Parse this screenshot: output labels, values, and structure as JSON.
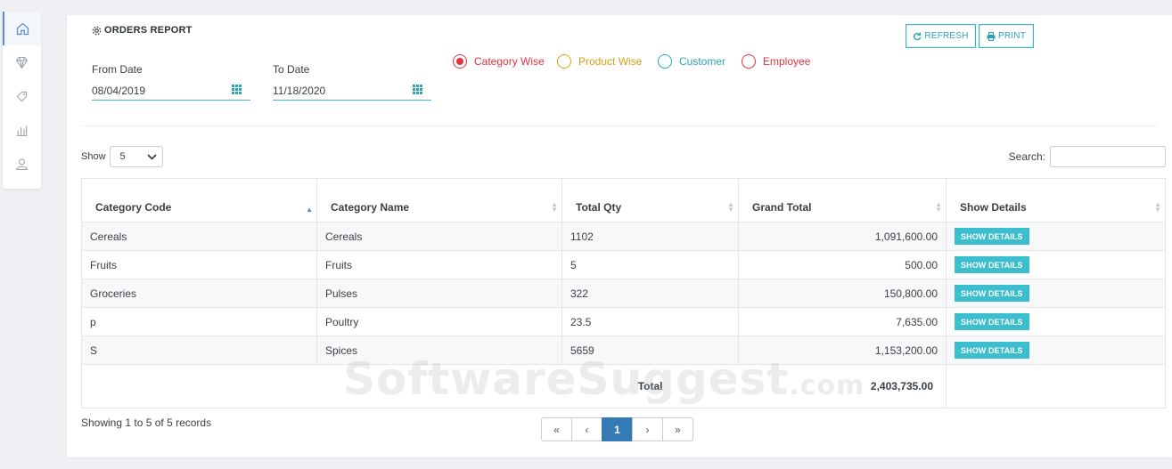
{
  "sidebar": {
    "items": [
      {
        "icon": "home-icon",
        "active": true
      },
      {
        "icon": "diamond-icon",
        "active": false
      },
      {
        "icon": "tag-icon",
        "active": false
      },
      {
        "icon": "bar-chart-icon",
        "active": false
      },
      {
        "icon": "user-icon",
        "active": false
      }
    ]
  },
  "report": {
    "title": "ORDERS REPORT",
    "from_label": "From Date",
    "from_value": "08/04/2019",
    "to_label": "To Date",
    "to_value": "11/18/2020"
  },
  "radios": [
    {
      "label": "Category Wise",
      "color": "#e0343f",
      "checked": true
    },
    {
      "label": "Product Wise",
      "color": "#d4a017",
      "checked": false
    },
    {
      "label": "Customer",
      "color": "#2aa5b5",
      "checked": false
    },
    {
      "label": "Employee",
      "color": "#e0343f",
      "checked": false
    }
  ],
  "toolbar": {
    "refresh_label": "REFRESH",
    "print_label": "PRINT"
  },
  "controls": {
    "show_label": "Show",
    "show_value": "5",
    "search_label": "Search:",
    "search_value": ""
  },
  "table": {
    "headers": [
      "Category Code",
      "Category Name",
      "Total Qty",
      "Grand Total",
      "Show Details"
    ],
    "rows": [
      {
        "code": "Cereals",
        "name": "Cereals",
        "qty": "1102",
        "total": "1,091,600.00",
        "action": "SHOW DETAILS"
      },
      {
        "code": "Fruits",
        "name": "Fruits",
        "qty": "5",
        "total": "500.00",
        "action": "SHOW DETAILS"
      },
      {
        "code": "Groceries",
        "name": "Pulses",
        "qty": "322",
        "total": "150,800.00",
        "action": "SHOW DETAILS"
      },
      {
        "code": "p",
        "name": "Poultry",
        "qty": "23.5",
        "total": "7,635.00",
        "action": "SHOW DETAILS"
      },
      {
        "code": "S",
        "name": "Spices",
        "qty": "5659",
        "total": "1,153,200.00",
        "action": "SHOW DETAILS"
      }
    ],
    "total_label": "Total",
    "total_value": "2,403,735.00"
  },
  "footer": {
    "records_text": "Showing 1 to 5 of 5 records",
    "pager": [
      "«",
      "‹",
      "1",
      "›",
      "»"
    ],
    "current_page": "1"
  },
  "watermark": {
    "main": "SoftwareSuggest",
    "suffix": ".com"
  },
  "colors": {
    "accent": "#3bbfcf",
    "page_active": "#337ab7"
  }
}
